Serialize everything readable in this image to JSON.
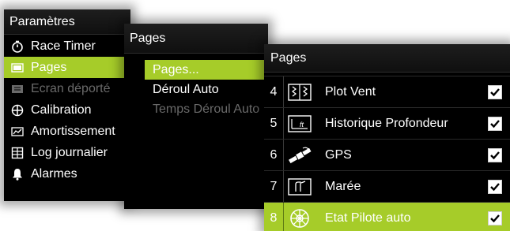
{
  "settings_panel": {
    "title": "Paramètres",
    "items": [
      {
        "label": "Race Timer",
        "icon": "timer-icon",
        "state": "normal"
      },
      {
        "label": "Pages",
        "icon": "pages-icon",
        "state": "selected"
      },
      {
        "label": "Ecran déporté",
        "icon": "remote-display-icon",
        "state": "disabled"
      },
      {
        "label": "Calibration",
        "icon": "calibration-icon",
        "state": "normal"
      },
      {
        "label": "Amortissement",
        "icon": "damping-icon",
        "state": "normal"
      },
      {
        "label": "Log journalier",
        "icon": "logbook-icon",
        "state": "normal"
      },
      {
        "label": "Alarmes",
        "icon": "bell-icon",
        "state": "normal"
      }
    ]
  },
  "pages_submenu": {
    "title": "Pages",
    "items": [
      {
        "label": "Pages...",
        "state": "selected"
      },
      {
        "label": "Déroul Auto",
        "state": "normal"
      },
      {
        "label": "Temps Déroul Auto",
        "state": "disabled"
      }
    ]
  },
  "pages_list": {
    "title": "Pages",
    "items": [
      {
        "number": "4",
        "label": "Plot Vent",
        "icon": "wind-plot-icon",
        "checked": true,
        "state": "normal"
      },
      {
        "number": "5",
        "label": "Historique Profondeur",
        "icon": "depth-history-icon",
        "checked": true,
        "state": "normal"
      },
      {
        "number": "6",
        "label": "GPS",
        "icon": "satellite-icon",
        "checked": true,
        "state": "normal"
      },
      {
        "number": "7",
        "label": "Marée",
        "icon": "tide-icon",
        "checked": true,
        "state": "normal"
      },
      {
        "number": "8",
        "label": "Etat Pilote auto",
        "icon": "autopilot-wheel-icon",
        "checked": true,
        "state": "selected"
      }
    ]
  },
  "colors": {
    "selection": "#a6cc29",
    "panel_background": "#000000",
    "disabled_text": "#6a6a6a",
    "text": "#ffffff"
  }
}
